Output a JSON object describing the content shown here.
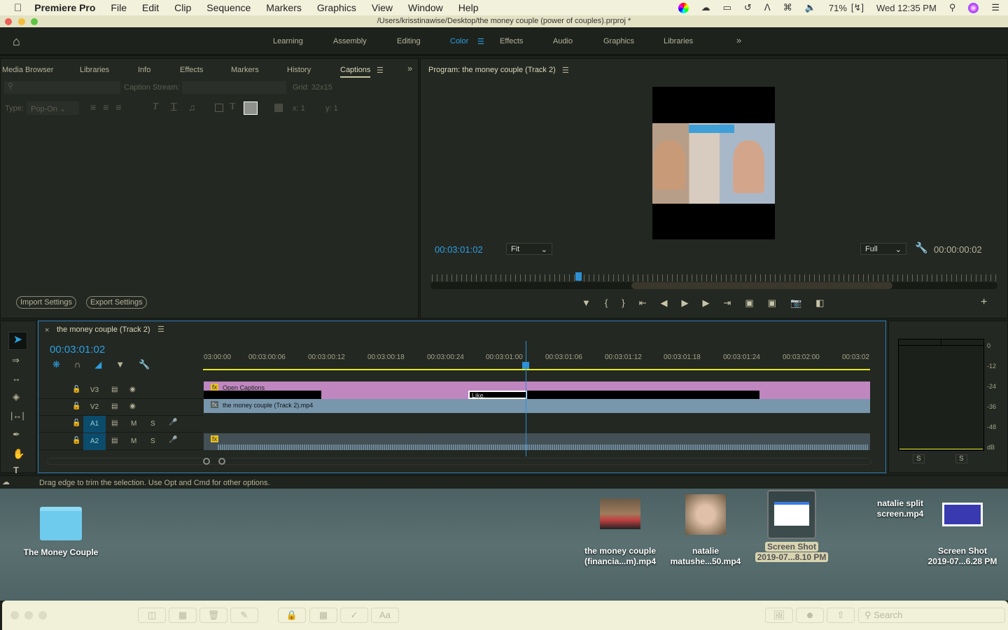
{
  "menubar": {
    "app": "Premiere Pro",
    "items": [
      "File",
      "Edit",
      "Clip",
      "Sequence",
      "Markers",
      "Graphics",
      "View",
      "Window",
      "Help"
    ],
    "battery": "71%",
    "clock": "Wed 12:35 PM"
  },
  "titlebar": {
    "path": "/Users/krisstinawise/Desktop/the money couple (power of couples).prproj *"
  },
  "workspace": {
    "tabs": [
      "Learning",
      "Assembly",
      "Editing",
      "Color",
      "Effects",
      "Audio",
      "Graphics",
      "Libraries"
    ],
    "active": "Color"
  },
  "left_panel": {
    "tabs": [
      "Media Browser",
      "Libraries",
      "Info",
      "Effects",
      "Markers",
      "History",
      "Captions"
    ],
    "active": "Captions",
    "caption_stream_label": "Caption Stream:",
    "grid": "Grid: 32x15",
    "type_label": "Type:",
    "type_value": "Pop-On",
    "x": "x:  1",
    "y": "y:  1",
    "import": "Import Settings",
    "export": "Export Settings"
  },
  "program": {
    "title": "Program: the money couple (Track 2)",
    "timecode": "00:03:01:02",
    "fit": "Fit",
    "quality": "Full",
    "duration": "00:00:00:02",
    "colors": {
      "accent": "#2d9fe0"
    }
  },
  "timeline": {
    "title": "the money couple (Track 2)",
    "timecode": "00:03:01:02",
    "ruler": [
      "00:03:00:00",
      "00:03:00:06",
      "00:03:00:12",
      "00:03:00:18",
      "00:03:00:24",
      "00:03:01:00",
      "00:03:01:06",
      "00:03:01:12",
      "00:03:01:18",
      "00:03:01:24",
      "00:03:02:00",
      "00:03:02"
    ],
    "tracks": [
      {
        "name": "V3"
      },
      {
        "name": "V2"
      },
      {
        "name": "A1",
        "m": "M",
        "s": "S"
      },
      {
        "name": "A2",
        "m": "M",
        "s": "S"
      }
    ],
    "clips": {
      "captions": "Open Captions",
      "caption_text": "Like,",
      "video": "the money couple (Track 2).mp4"
    },
    "colors": {
      "captions": "#bf86c0",
      "video": "#7897ad",
      "audio": "#435056"
    }
  },
  "meter": {
    "scale": [
      "0",
      "-12",
      "-24",
      "-36",
      "-48",
      "dB"
    ],
    "solo": [
      "S",
      "S"
    ]
  },
  "statusbar": {
    "text": "Drag edge to trim the selection. Use Opt and Cmd for other options."
  },
  "desktop": {
    "items": [
      {
        "label": "The Money Couple"
      },
      {
        "label": "the money couple (financia...m).mp4"
      },
      {
        "label": "natalie matushe...50.mp4"
      },
      {
        "label1": "Screen Shot",
        "label2": "2019-07...8.10 PM"
      },
      {
        "label": "natalie split screen.mp4"
      },
      {
        "label1": "Screen Shot",
        "label2": "2019-07...6.28 PM"
      }
    ]
  },
  "finder": {
    "search_placeholder": "Search",
    "aa": "Aa"
  }
}
